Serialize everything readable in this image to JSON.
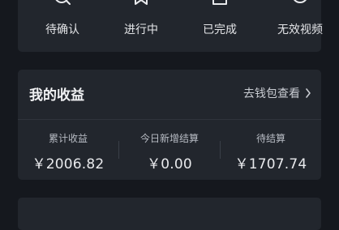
{
  "status_tabs": [
    {
      "label": "待确认",
      "icon": "search-icon"
    },
    {
      "label": "进行中",
      "icon": "bookmark-icon"
    },
    {
      "label": "已完成",
      "icon": "document-icon"
    },
    {
      "label": "无效视频",
      "icon": "clock-icon"
    }
  ],
  "earnings": {
    "title": "我的收益",
    "wallet_link": "去钱包查看",
    "stats": [
      {
        "label": "累计收益",
        "value": "￥2006.82"
      },
      {
        "label": "今日新增结算",
        "value": "￥0.00"
      },
      {
        "label": "待结算",
        "value": "￥1707.74"
      }
    ]
  },
  "colors": {
    "background": "#15181e",
    "card": "#22262d",
    "text": "#e8e9ec",
    "muted": "#b8bcc4"
  }
}
